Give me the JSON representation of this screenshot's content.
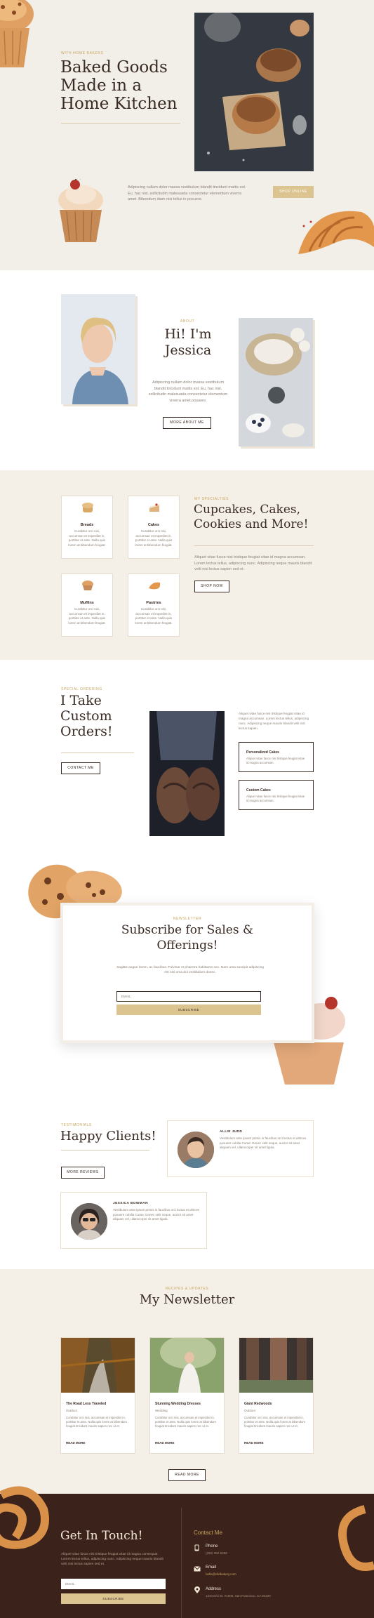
{
  "hero": {
    "eyebrow": "WITH HOME BAKERS",
    "title_lines": [
      "Baked Goods",
      "Made in a",
      "Home Kitchen"
    ],
    "text": "Adipiscing nullam dolor massa vestibulum blandit tincidunt mattis est. Eu, hac nisl, sollicitudin malesuada consectetur elementum viverra amet. Bibendum diam nisi tellus in posuere.",
    "button": "SHOP ONLINE"
  },
  "about": {
    "eyebrow": "ABOUT",
    "title_lines": [
      "Hi! I'm",
      "Jessica"
    ],
    "text": "Adipiscing nullam dolor massa vestibulum blandit tincidunt mattis est. Eu, hac nisl, sollicitudin malesuada consectetur elementum viverra amet posuere.",
    "button": "MORE ABOUT ME"
  },
  "specialties": {
    "eyebrow": "MY SPECIALTIES",
    "title_lines": [
      "Cupcakes, Cakes,",
      "Cookies and More!"
    ],
    "text": "Aliquet vitae fusce nisi tristique feugiat vitae id magna accumsan. Lorem lectus tellus, adipiscing nunc. Adipiscing neque mauris blandit velit nisi lectus sapien sed et.",
    "button": "SHOP NOW",
    "items": [
      {
        "name": "Breads",
        "text": "Curabitur orci nisi, accumsan et imperdiet in, porttitor et ante. Nulla quis lorem at bibendum feugiat."
      },
      {
        "name": "Cakes",
        "text": "Curabitur orci nisi, accumsan et imperdiet in, porttitor et ante. Nulla quis lorem at bibendum feugiat."
      },
      {
        "name": "Muffins",
        "text": "Curabitur orci nisi, accumsan et imperdiet in, porttitor et ante. Nulla quis lorem at bibendum feugiat."
      },
      {
        "name": "Pastries",
        "text": "Curabitur orci nisi, accumsan et imperdiet in, porttitor et ante. Nulla quis lorem at bibendum feugiat."
      }
    ]
  },
  "orders": {
    "eyebrow": "SPECIAL ORDERING",
    "title_lines": [
      "I Take",
      "Custom",
      "Orders!"
    ],
    "button": "CONTACT ME",
    "text": "Aliquet vitae fusce nisi tristique feugiat vitae id magna accumsan. Lorem lectus tellus, adipiscing nunc. Adipiscing neque mauris blandit velit nisi lectus sapien.",
    "options": [
      {
        "title": "Personalized Cakes",
        "text": "Aliquet vitae fusce nisi tristique feugiat vitae id magna accumsan."
      },
      {
        "title": "Custom Cakes",
        "text": "Aliquet vitae fusce nisi tristique feugiat vitae id magna accumsan."
      }
    ]
  },
  "subscribe": {
    "eyebrow": "NEWSLETTER",
    "title_lines": [
      "Subscribe for Sales &",
      "Offerings!"
    ],
    "text": "Sagittis augue lorem, ac faucibus. Pulvinar et pharetra habitasse nec. Nam urna suscipit adipiscing est nisi urna dui vestibulum donec.",
    "email_placeholder": "EMAIL",
    "button": "SUBSCRIBE"
  },
  "testimonials": {
    "eyebrow": "TESTIMONIALS",
    "title": "Happy Clients!",
    "button": "MORE REVIEWS",
    "reviews": [
      {
        "name": "ALLIE JUDD",
        "text": "Vestibulum ante ipsum primis in faucibus orci luctus et ultrices posuere cubilia Curae; Donec velit neque, auctor sit amet aliquam vel, ullamcorper sit amet ligula."
      },
      {
        "name": "JESSICA BOWMAN",
        "text": "Vestibulum ante ipsum primis in faucibus orci luctus et ultrices posuere cubilia Curae; Donec velit neque, auctor sit amet aliquam vel, ullamcorper sit amet ligula."
      }
    ]
  },
  "newsletter": {
    "eyebrow": "RECIPES & UPDATES",
    "title": "My Newsletter",
    "posts": [
      {
        "title": "The Road Less Traveled",
        "category": "Outdoor",
        "excerpt": "Curabitur orci nisi, accumsan et imperdiet in, porttitor et ante. Nulla quis lorem at bibendum feugiat tincidunt mauris sapien nec ut et.",
        "link": "READ MORE"
      },
      {
        "title": "Stunning Wedding Dresses",
        "category": "Wedding",
        "excerpt": "Curabitur orci nisi, accumsan et imperdiet in, porttitor et ante. Nulla quis lorem at bibendum feugiat tincidunt mauris sapien nec ut et.",
        "link": "READ MORE"
      },
      {
        "title": "Giant Redwoods",
        "category": "Outdoor",
        "excerpt": "Curabitur orci nisi, accumsan et imperdiet in, porttitor et ante. Nulla quis lorem at bibendum feugiat tincidunt mauris sapien nec ut et.",
        "link": "READ MORE"
      }
    ],
    "button": "READ MORE"
  },
  "footer": {
    "title": "Get In Touch!",
    "text": "Aliquet vitae fusce nisi tristique feugiat vitae id magna consequat. Lorem lectus tellus, adipiscing nunc. Adipiscing neque mauris blandit velit nisi lectus sapien sed et.",
    "email_placeholder": "EMAIL",
    "button": "SUBSCRIBE",
    "contact_title": "Contact Me",
    "phone_label": "Phone",
    "phone": "(255) 352-6258",
    "email_label": "Email",
    "email": "hello@divibakery.com",
    "address_label": "Address",
    "address": "1234 Divi St. #1000, San Francisco, CA 94220"
  },
  "colors": {
    "accent": "#c9a45c",
    "button_fill": "#dcc490",
    "dark": "#3a2a24",
    "footer_bg": "#3b231c",
    "cream": "#f4f0e8"
  }
}
